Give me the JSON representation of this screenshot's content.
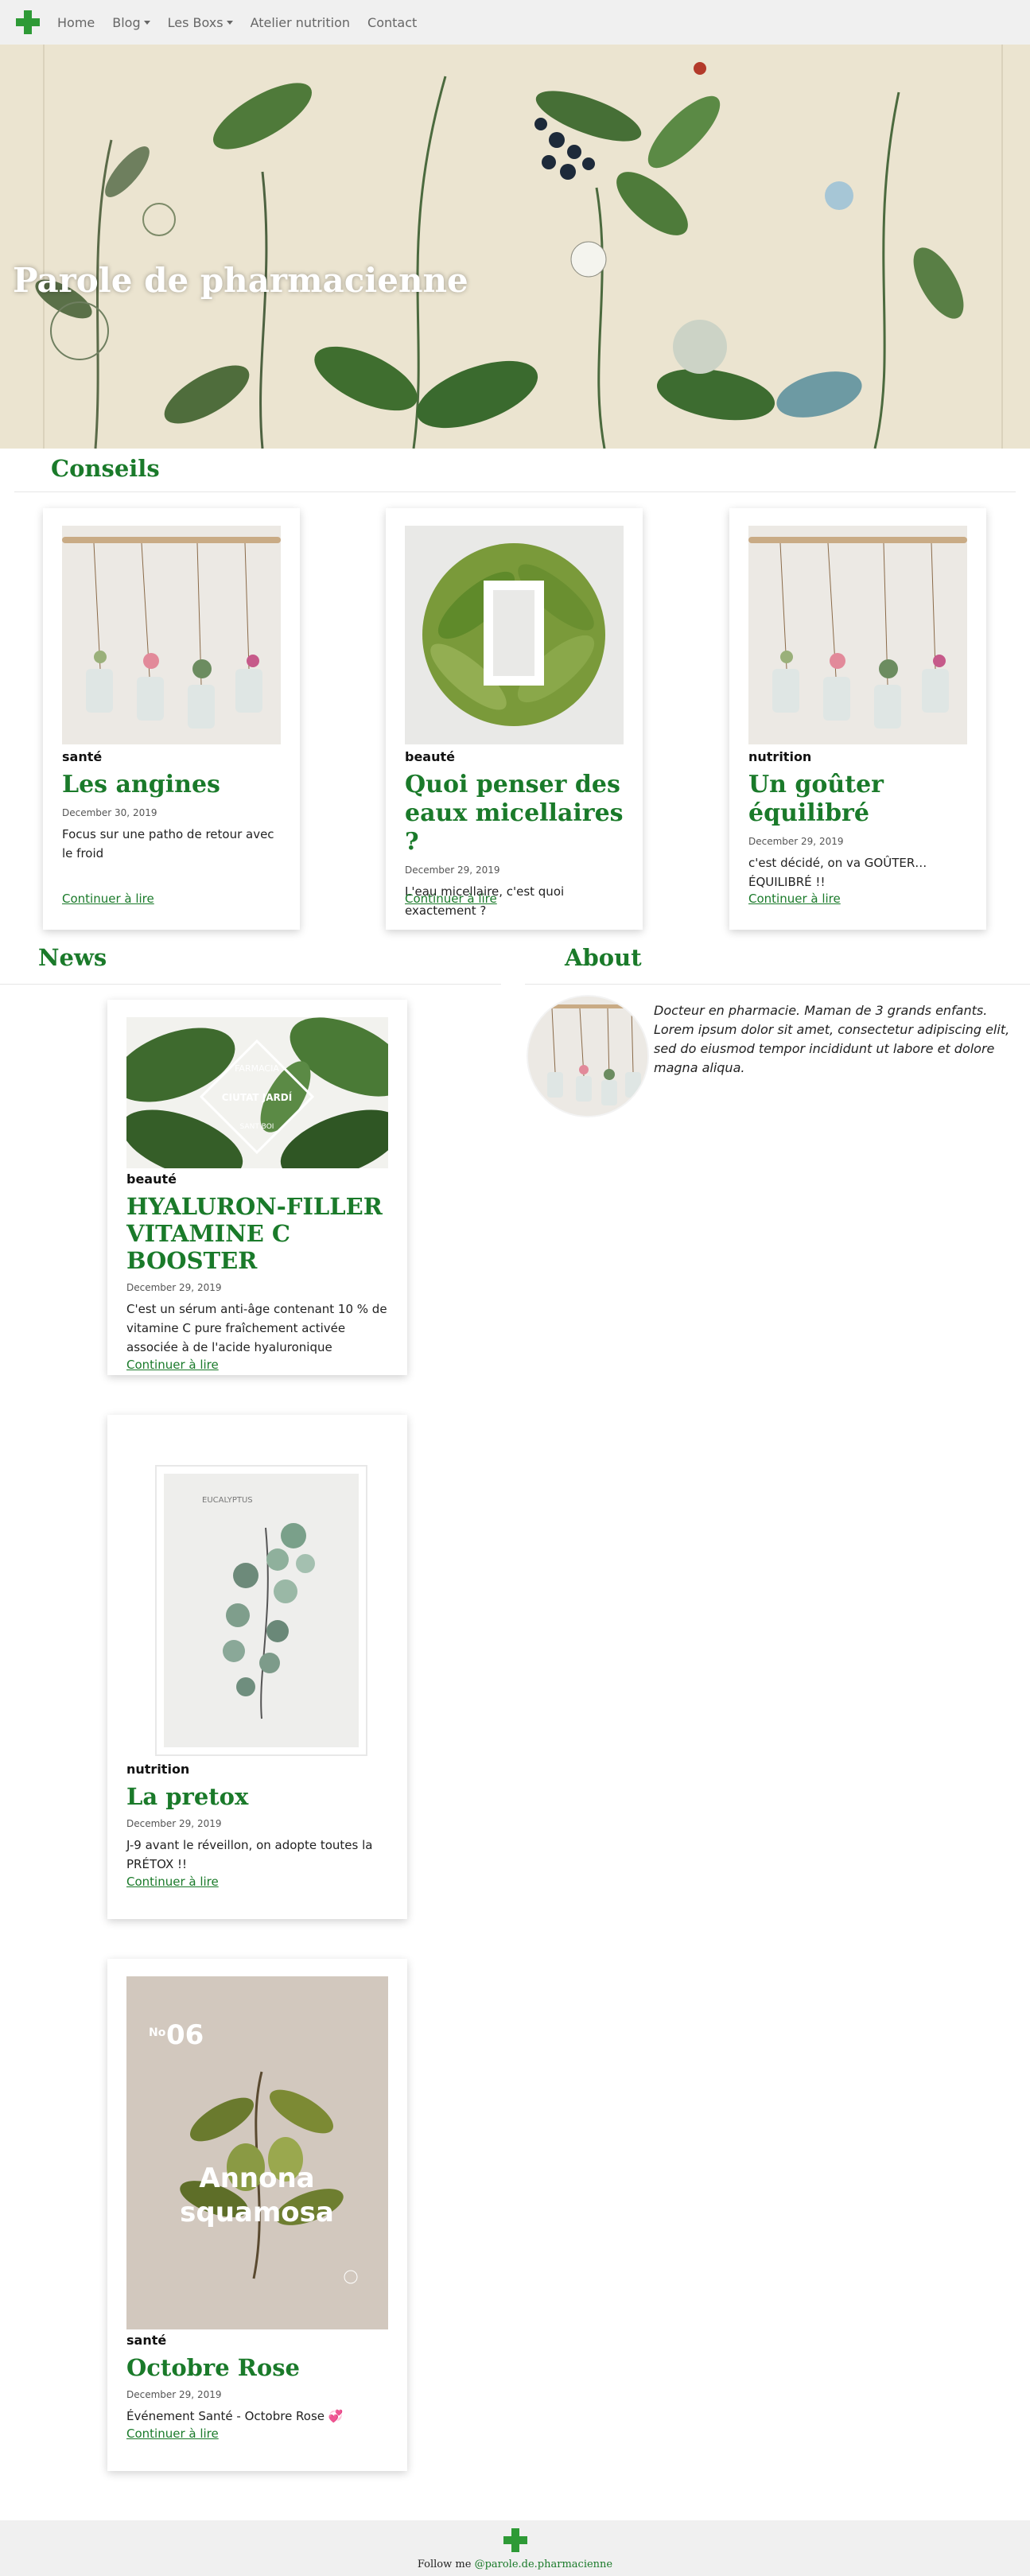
{
  "nav": {
    "items": [
      {
        "label": "Home"
      },
      {
        "label": "Blog"
      },
      {
        "label": "Les Boxs"
      },
      {
        "label": "Atelier nutrition"
      },
      {
        "label": "Contact"
      }
    ]
  },
  "hero": {
    "title": "Parole de pharmacienne"
  },
  "conseils": {
    "heading": "Conseils",
    "cards": [
      {
        "category": "santé",
        "title": "Les angines",
        "date": "December 30, 2019",
        "excerpt": "Focus sur une patho de retour avec le froid",
        "more": "Continuer à lire"
      },
      {
        "category": "beauté",
        "title": "Quoi penser des eaux micellaires ?",
        "date": "December 29, 2019",
        "excerpt": "L'eau micellaire, c'est quoi exactement ?",
        "more": "Continuer à lire"
      },
      {
        "category": "nutrition",
        "title": "Un goûter équilibré",
        "date": "December 29, 2019",
        "excerpt": "c'est décidé, on va GOÛTER… ÉQUILIBRÉ !!",
        "more": "Continuer à lire"
      }
    ]
  },
  "news": {
    "heading": "News",
    "cards": [
      {
        "category": "beauté",
        "title": "HYALURON-FILLER VITAMINE C BOOSTER",
        "date": "December 29, 2019",
        "excerpt": "C'est un sérum anti-âge contenant 10 % de vitamine C pure fraîchement activée associée à de l'acide hyaluronique",
        "more": "Continuer à lire",
        "image_text": [
          "FARMACIA",
          "CIUTAT JARDÍ",
          "SANT BOI"
        ]
      },
      {
        "category": "nutrition",
        "title": "La pretox",
        "date": "December 29, 2019",
        "excerpt": "J-9 avant le réveillon, on adopte toutes la PRÉTOX !!",
        "more": "Continuer à lire",
        "image_text": [
          "EUCALYPTUS"
        ]
      },
      {
        "category": "santé",
        "title": "Octobre Rose",
        "date": "December 29, 2019",
        "excerpt": "Événement Santé - Octobre Rose 💞",
        "more": "Continuer à lire",
        "image_text": [
          "No",
          "06",
          "Annona",
          "squamosa"
        ]
      }
    ]
  },
  "about": {
    "heading": "About",
    "text": "Docteur en pharmacie. Maman de 3 grands enfants. Lorem ipsum dolor sit amet, consectetur adipiscing elit, sed do eiusmod tempor incididunt ut labore et dolore magna aliqua."
  },
  "footer": {
    "prefix": "Follow me",
    "handle": "@parole.de.pharmacienne"
  },
  "colors": {
    "accent": "#1a7a2a",
    "logo": "#2e9a36",
    "nav_bg": "#f0f0f0"
  }
}
